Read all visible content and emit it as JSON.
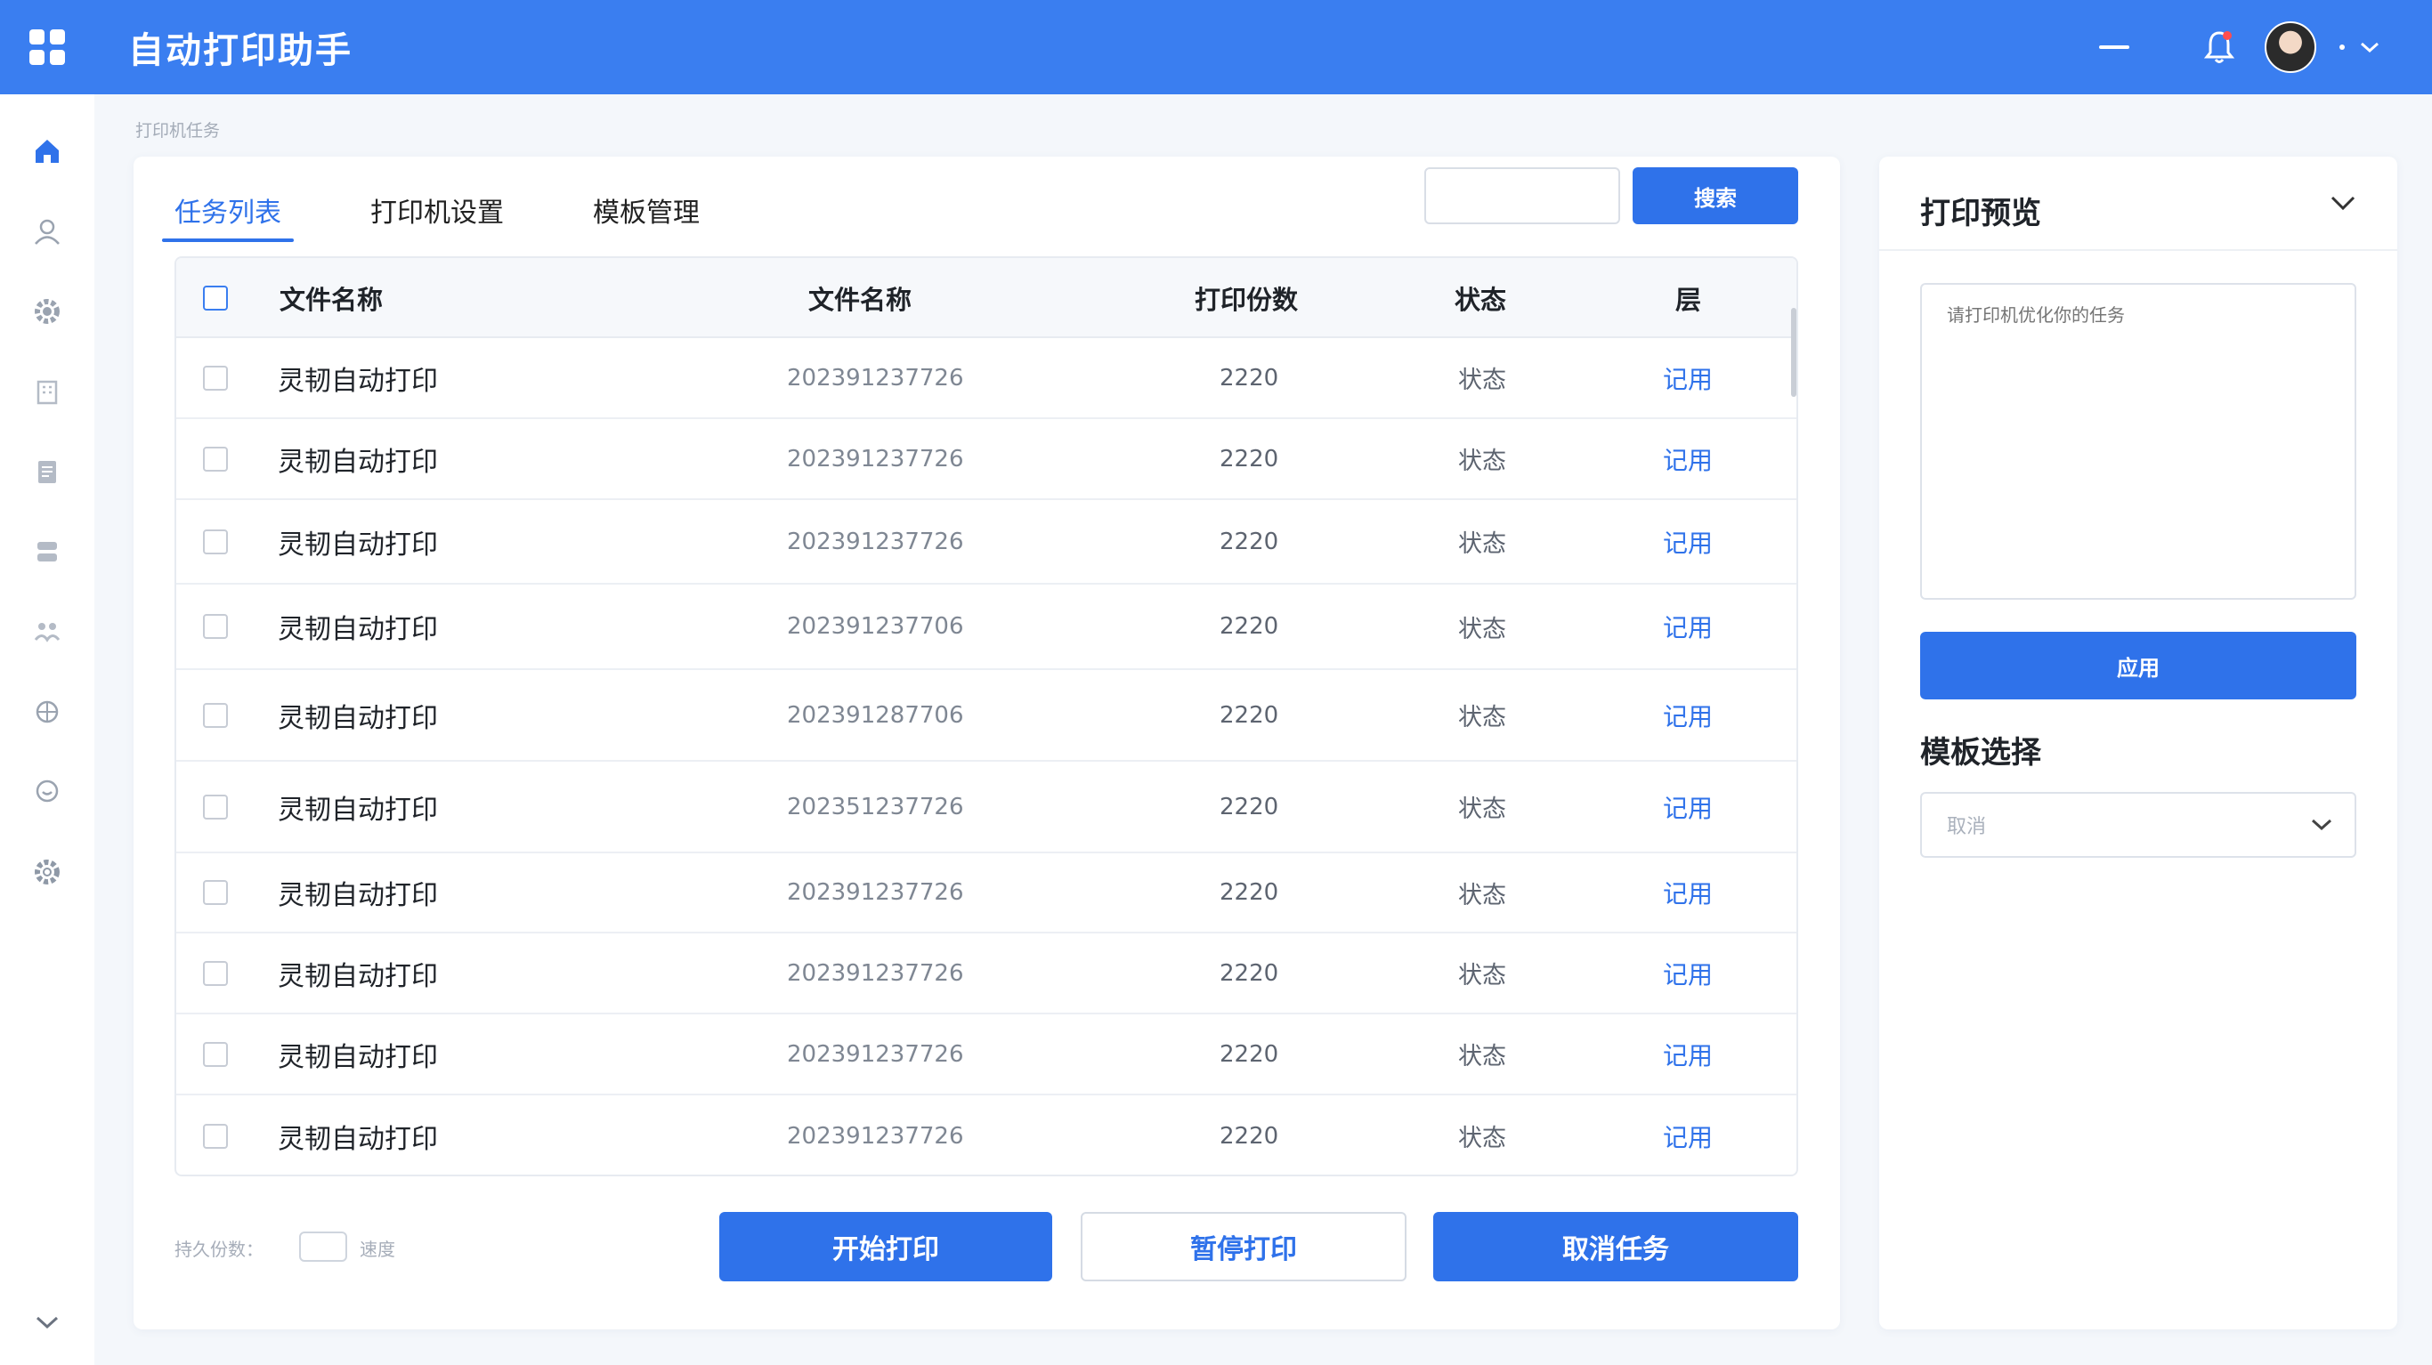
{
  "app": {
    "title": "自动打印助手"
  },
  "breadcrumb": "打印机任务",
  "sidebar": {
    "items": [
      {
        "icon": "home-icon"
      },
      {
        "icon": "user-icon"
      },
      {
        "icon": "gear-icon"
      },
      {
        "icon": "building-icon"
      },
      {
        "icon": "document-icon"
      },
      {
        "icon": "database-icon"
      },
      {
        "icon": "people-icon"
      },
      {
        "icon": "globe-icon"
      },
      {
        "icon": "chat-icon"
      },
      {
        "icon": "settings-icon"
      }
    ]
  },
  "tabs": [
    {
      "label": "任务列表",
      "active": true
    },
    {
      "label": "打印机设置",
      "active": false
    },
    {
      "label": "模板管理",
      "active": false
    }
  ],
  "search": {
    "value": "",
    "placeholder": "",
    "button_label": "搜索"
  },
  "table": {
    "headers": [
      "文件名称",
      "文件名称",
      "打印份数",
      "状态",
      "层"
    ],
    "rows": [
      {
        "name": "灵韧自动打印",
        "id": "202391237726",
        "copies": "2220",
        "status": "状态",
        "action": "记用"
      },
      {
        "name": "灵韧自动打印",
        "id": "202391237726",
        "copies": "2220",
        "status": "状态",
        "action": "记用"
      },
      {
        "name": "灵韧自动打印",
        "id": "202391237726",
        "copies": "2220",
        "status": "状态",
        "action": "记用"
      },
      {
        "name": "灵韧自动打印",
        "id": "202391237706",
        "copies": "2220",
        "status": "状态",
        "action": "记用"
      },
      {
        "name": "灵韧自动打印",
        "id": "202391287706",
        "copies": "2220",
        "status": "状态",
        "action": "记用"
      },
      {
        "name": "灵韧自动打印",
        "id": "202351237726",
        "copies": "2220",
        "status": "状态",
        "action": "记用"
      },
      {
        "name": "灵韧自动打印",
        "id": "202391237726",
        "copies": "2220",
        "status": "状态",
        "action": "记用"
      },
      {
        "name": "灵韧自动打印",
        "id": "202391237726",
        "copies": "2220",
        "status": "状态",
        "action": "记用"
      },
      {
        "name": "灵韧自动打印",
        "id": "202391237726",
        "copies": "2220",
        "status": "状态",
        "action": "记用"
      },
      {
        "name": "灵韧自动打印",
        "id": "202391237726",
        "copies": "2220",
        "status": "状态",
        "action": "记用"
      }
    ]
  },
  "footer": {
    "label": "持久份数：",
    "after_label": "速度",
    "start_label": "开始打印",
    "pause_label": "暂停打印",
    "cancel_label": "取消任务"
  },
  "preview": {
    "title": "打印预览",
    "placeholder": "请打印机优化你的任务",
    "apply_label": "应用",
    "template_title": "模板选择",
    "template_value": "取消"
  },
  "colors": {
    "primary": "#2f72ea",
    "topbar": "#3a7ef0"
  }
}
